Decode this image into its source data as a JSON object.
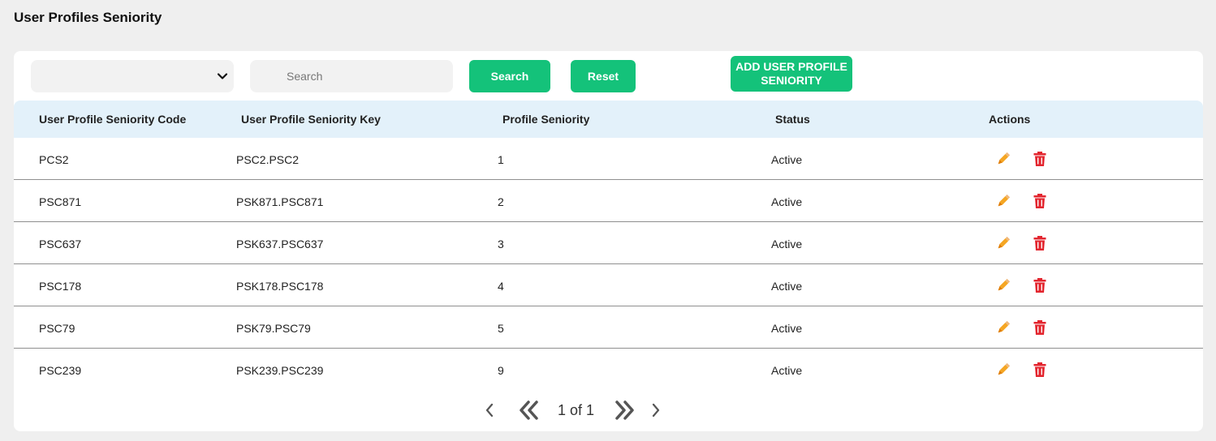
{
  "page": {
    "title": "User Profiles Seniority"
  },
  "toolbar": {
    "select_value": "",
    "search_placeholder": "Search",
    "search_value": "",
    "search_button": "Search",
    "reset_button": "Reset",
    "add_button": "ADD USER PROFILE SENIORITY"
  },
  "colors": {
    "accent": "#14c27a",
    "header_bg": "#e3f1fa",
    "edit_icon": "#f5a623",
    "delete_icon": "#e3262f"
  },
  "table": {
    "headers": [
      "User Profile Seniority Code",
      "User Profile Seniority Key",
      "Profile Seniority",
      "Status",
      "Actions"
    ],
    "rows": [
      {
        "code": "PCS2",
        "key": "PSC2.PSC2",
        "seniority": "1",
        "status": "Active"
      },
      {
        "code": "PSC871",
        "key": "PSK871.PSC871",
        "seniority": "2",
        "status": "Active"
      },
      {
        "code": "PSC637",
        "key": "PSK637.PSC637",
        "seniority": "3",
        "status": "Active"
      },
      {
        "code": "PSC178",
        "key": "PSK178.PSC178",
        "seniority": "4",
        "status": "Active"
      },
      {
        "code": "PSC79",
        "key": "PSK79.PSC79",
        "seniority": "5",
        "status": "Active"
      },
      {
        "code": "PSC239",
        "key": "PSK239.PSC239",
        "seniority": "9",
        "status": "Active"
      }
    ],
    "action_icons": [
      "pencil-icon",
      "trash-icon"
    ]
  },
  "pagination": {
    "text": "1 of 1"
  }
}
